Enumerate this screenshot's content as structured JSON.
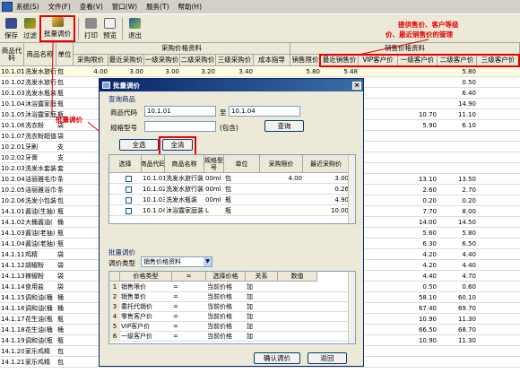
{
  "menubar": {
    "items": [
      "系统(S)",
      "文件(F)",
      "查看(V)",
      "窗口(W)",
      "服务(T)",
      "帮助(H)"
    ]
  },
  "toolbar": {
    "buttons": [
      "保存",
      "过滤",
      "批量调价",
      "打印",
      "预览",
      "退出"
    ]
  },
  "main": {
    "group_header_purchase": "采购价格资料",
    "group_header_sale": "销售价格资料",
    "columns": [
      "商品代码",
      "商品名称",
      "单位",
      "采购限价",
      "最近采购价",
      "一级采购价",
      "二级采购价",
      "三级采购价",
      "成本指导",
      "销售限价",
      "最近销售价",
      "VIP客户价",
      "一级客户价",
      "二级客户价",
      "三级客户价"
    ],
    "rows": [
      {
        "code": "10.1.01",
        "name": "洗发水旅行",
        "unit": "包",
        "p_limit": "4.00",
        "p_recent": "3.00",
        "p1": "3.00",
        "p2": "3.20",
        "p3": "3.40",
        "cost": "",
        "s_limit": "5.80",
        "s_recent": "5.48",
        "vip": "",
        "c1": "",
        "c2": "5.80",
        "c3": ""
      },
      {
        "code": "10.1.02",
        "name": "洗发水旅行",
        "unit": "包",
        "c2": "0.50"
      },
      {
        "code": "10.1.03",
        "name": "洗发水瓶装",
        "unit": "瓶",
        "c2": "6.40"
      },
      {
        "code": "10.1.04",
        "name": "沐浴露家庭",
        "unit": "瓶",
        "c2": "14.90"
      },
      {
        "code": "10.1.05",
        "name": "沐浴露家庭",
        "unit": "瓶",
        "c1": "10.70",
        "c2": "11.10"
      },
      {
        "code": "10.1.06",
        "name": "洗衣粉",
        "unit": "袋",
        "c1": "5.90",
        "c2": "6.10"
      },
      {
        "code": "10.1.07",
        "name": "洗衣粉超值",
        "unit": "袋"
      },
      {
        "code": "10.2.01",
        "name": "牙刷",
        "unit": "支"
      },
      {
        "code": "10.2.02",
        "name": "牙膏",
        "unit": "支"
      },
      {
        "code": "10.2.03",
        "name": "洗发水套装",
        "unit": "套"
      },
      {
        "code": "10.2.04",
        "name": "洁丽雅毛巾",
        "unit": "条",
        "c1": "13.10",
        "c2": "13.50"
      },
      {
        "code": "10.2.05",
        "name": "洁丽雅浴巾",
        "unit": "条",
        "c1": "2.60",
        "c2": "2.70"
      },
      {
        "code": "10.2.06",
        "name": "洗发小包装",
        "unit": "包",
        "c1": "0.20",
        "c2": "0.20"
      },
      {
        "code": "14.1.01",
        "name": "酱油(生抽)",
        "unit": "瓶",
        "c1": "7.70",
        "c2": "8.00"
      },
      {
        "code": "14.1.02",
        "name": "大桶酱油(",
        "unit": "桶",
        "c1": "14.00",
        "c2": "14.50"
      },
      {
        "code": "14.1.03",
        "name": "酱油(老抽)",
        "unit": "瓶",
        "c1": "5.60",
        "c2": "5.80"
      },
      {
        "code": "14.1.04",
        "name": "酱油(老抽)",
        "unit": "瓶",
        "c1": "6.30",
        "c2": "6.50"
      },
      {
        "code": "14.1.11",
        "name": "鸡精",
        "unit": "袋",
        "c1": "4.20",
        "c2": "4.40"
      },
      {
        "code": "14.1.12",
        "name": "胡椒粉",
        "unit": "袋",
        "c1": "4.20",
        "c2": "4.40"
      },
      {
        "code": "14.1.13",
        "name": "辣椒粉",
        "unit": "袋",
        "c1": "4.40",
        "c2": "4.70"
      },
      {
        "code": "14.1.14",
        "name": "食用盐",
        "unit": "袋",
        "c1": "0.50",
        "c2": "0.60"
      },
      {
        "code": "14.1.15",
        "name": "调和油(桶",
        "unit": "桶",
        "c1": "58.10",
        "c2": "60.10"
      },
      {
        "code": "14.1.16",
        "name": "调和油(桶",
        "unit": "桶",
        "c1": "67.40",
        "c2": "69.70"
      },
      {
        "code": "14.1.17",
        "name": "花生油(瓶",
        "unit": "瓶",
        "c1": "10.90",
        "c2": "11.30"
      },
      {
        "code": "14.1.18",
        "name": "花生油(桶",
        "unit": "桶",
        "c1": "66.50",
        "c2": "68.70"
      },
      {
        "code": "14.1.19",
        "name": "调和油(瓶",
        "unit": "瓶",
        "c1": "10.90",
        "c2": "11.30"
      },
      {
        "code": "14.1.20",
        "name": "家乐鸡精",
        "unit": "包",
        "c1": "",
        "c2": ""
      },
      {
        "code": "14.1.21",
        "name": "家乐鸡精",
        "unit": "包",
        "c1": "",
        "c2": ""
      }
    ]
  },
  "annotations": {
    "batch": "批量调价",
    "right_line1": "提供售价、客户等级",
    "right_line2": "价、最近销售价的管理"
  },
  "dialog": {
    "title": "批量调价",
    "query_group": "查询商品",
    "code_label": "商品代码",
    "code_from": "10.1.01",
    "to_label": "至",
    "code_to": "10.1.04",
    "spec_label": "规格型号",
    "contain_label": "(包含)",
    "query_btn": "查询",
    "select_all_btn": "全选",
    "clear_all_btn": "全清",
    "list_columns": [
      "选择",
      "商品代码",
      "商品名称",
      "规格型号",
      "单位",
      "采购限价",
      "最近采购价"
    ],
    "list_rows": [
      {
        "code": "10.1.01",
        "name": "洗发水旅行装",
        "spec": "00ml",
        "unit": "包",
        "limit": "4.00",
        "recent": "3.00"
      },
      {
        "code": "10.1.02",
        "name": "洗发水旅行装",
        "spec": "00ml",
        "unit": "包",
        "limit": "",
        "recent": "0.26"
      },
      {
        "code": "10.1.03",
        "name": "洗发水瓶装",
        "spec": "00ml",
        "unit": "瓶",
        "limit": "",
        "recent": "4.90"
      },
      {
        "code": "10.1.04",
        "name": "沐浴露家庭装",
        "spec": "L",
        "unit": "瓶",
        "limit": "",
        "recent": "10.00"
      }
    ],
    "batch_group": "批量调价",
    "type_label": "调价类型",
    "type_value": "销售价格资料",
    "rule_columns": [
      "价格类型",
      "=",
      "选择价格",
      "关系",
      "数值"
    ],
    "rule_rows": [
      {
        "type": "销售限价",
        "eq": "=",
        "price": "当前价格",
        "rel": "加"
      },
      {
        "type": "销售单价",
        "eq": "=",
        "price": "当前价格",
        "rel": "加"
      },
      {
        "type": "委托代销价",
        "eq": "=",
        "price": "当前价格",
        "rel": "加"
      },
      {
        "type": "零售客户价",
        "eq": "=",
        "price": "当前价格",
        "rel": "加"
      },
      {
        "type": "VIP客户价",
        "eq": "=",
        "price": "当前价格",
        "rel": "加"
      },
      {
        "type": "一级客户价",
        "eq": "=",
        "price": "当前价格",
        "rel": "加"
      }
    ],
    "confirm_btn": "确认调价",
    "back_btn": "返回"
  }
}
